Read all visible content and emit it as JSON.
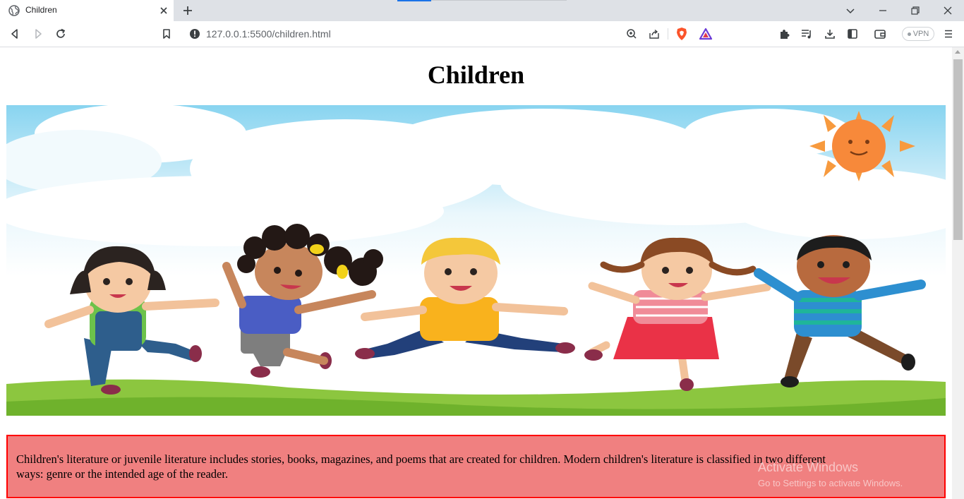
{
  "browser": {
    "tab": {
      "title": "Children"
    },
    "address": {
      "url": "127.0.0.1:5500/children.html"
    },
    "vpn_label": "VPN",
    "icons": [
      "globe-icon",
      "close-icon",
      "plus-icon",
      "chevron-down-icon",
      "minimize-icon",
      "restore-icon",
      "back-icon",
      "forward-icon",
      "reload-icon",
      "bookmark-icon",
      "info-icon",
      "zoom-icon",
      "share-icon",
      "brave-shield-icon",
      "brave-rewards-icon",
      "extensions-icon",
      "playlist-icon",
      "download-icon",
      "sidebar-icon",
      "wallet-icon",
      "menu-icon"
    ]
  },
  "page": {
    "heading": "Children",
    "hero_image": {
      "subject": "cartoon children jumping under a sunny sky"
    },
    "paragraph": "Children's literature or juvenile literature includes stories, books, magazines, and poems that are created for children. Modern children's literature is classified in two different ways: genre or the intended age of the reader.",
    "colors": {
      "box_background": "#f08080",
      "box_border": "#ff0000"
    }
  },
  "os_watermark": {
    "line1": "Activate Windows",
    "line2": "Go to Settings to activate Windows."
  }
}
